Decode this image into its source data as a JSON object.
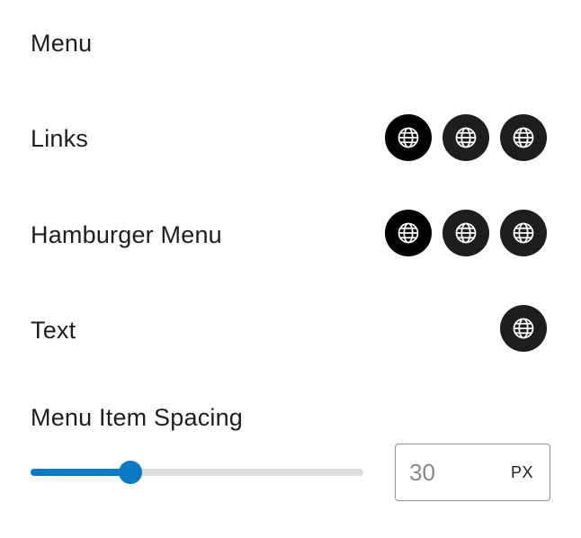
{
  "heading": "Menu",
  "rows": [
    {
      "label": "Links",
      "swatches": [
        {
          "icon": "globe-icon",
          "color": "#000000"
        },
        {
          "icon": "globe-icon",
          "color": "#1e1e1e"
        },
        {
          "icon": "globe-icon",
          "color": "#1e1e1e"
        }
      ]
    },
    {
      "label": "Hamburger Menu",
      "swatches": [
        {
          "icon": "globe-icon",
          "color": "#000000"
        },
        {
          "icon": "globe-icon",
          "color": "#1e1e1e"
        },
        {
          "icon": "globe-icon",
          "color": "#1e1e1e"
        }
      ]
    },
    {
      "label": "Text",
      "swatches": [
        {
          "icon": "globe-icon",
          "color": "#1e1e1e"
        }
      ]
    }
  ],
  "spacing": {
    "label": "Menu Item Spacing",
    "value": "30",
    "unit": "PX",
    "slider_fraction": 0.3,
    "accent": "#0a7ac4"
  }
}
